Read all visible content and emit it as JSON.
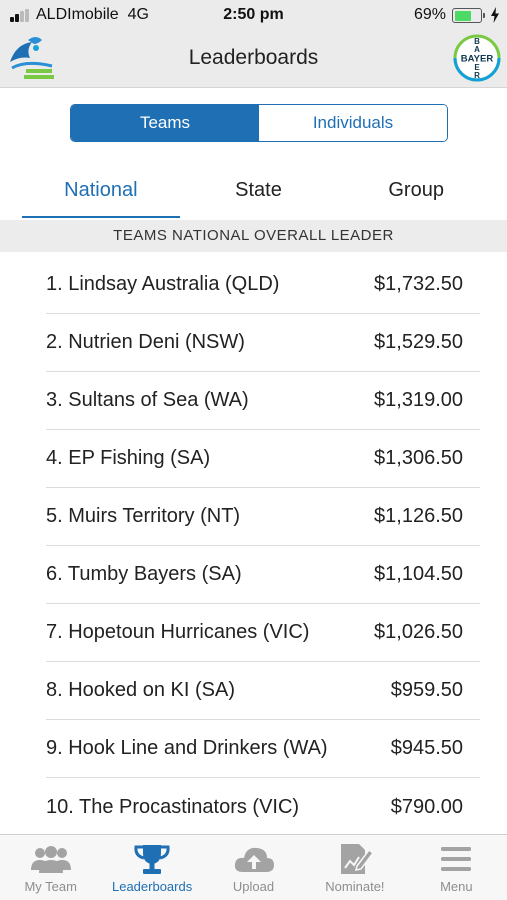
{
  "status_bar": {
    "carrier": "ALDImobile",
    "network": "4G",
    "time": "2:50 pm",
    "battery_pct": "69%",
    "battery_level": 0.69,
    "signal_bars": 2
  },
  "header": {
    "title": "Leaderboards",
    "left_logo_icon": "fishing-challenge-logo",
    "right_logo_icon": "bayer-cross-logo",
    "bayer_text": "BAYER"
  },
  "segmented": {
    "options": [
      "Teams",
      "Individuals"
    ],
    "selected": "Teams"
  },
  "tabs": {
    "items": [
      "National",
      "State",
      "Group"
    ],
    "selected": "National"
  },
  "section_title": "TEAMS NATIONAL OVERALL LEADER",
  "leaderboard": [
    {
      "name": "1. Lindsay Australia (QLD)",
      "amount": "$1,732.50"
    },
    {
      "name": "2. Nutrien Deni (NSW)",
      "amount": "$1,529.50"
    },
    {
      "name": "3. Sultans of Sea (WA)",
      "amount": "$1,319.00"
    },
    {
      "name": "4. EP Fishing (SA)",
      "amount": "$1,306.50"
    },
    {
      "name": "5. Muirs Territory (NT)",
      "amount": "$1,126.50"
    },
    {
      "name": "6. Tumby Bayers (SA)",
      "amount": "$1,104.50"
    },
    {
      "name": "7. Hopetoun Hurricanes (VIC)",
      "amount": "$1,026.50"
    },
    {
      "name": "8. Hooked on KI (SA)",
      "amount": "$959.50"
    },
    {
      "name": "9. Hook Line and Drinkers (WA)",
      "amount": "$945.50"
    },
    {
      "name": "10. The Procastinators (VIC)",
      "amount": "$790.00"
    }
  ],
  "bottom_nav": {
    "items": [
      {
        "label": "My Team",
        "icon": "team-icon"
      },
      {
        "label": "Leaderboards",
        "icon": "trophy-icon"
      },
      {
        "label": "Upload",
        "icon": "cloud-upload-icon"
      },
      {
        "label": "Nominate!",
        "icon": "nominate-icon"
      },
      {
        "label": "Menu",
        "icon": "menu-icon"
      }
    ],
    "selected": "Leaderboards"
  },
  "colors": {
    "accent": "#1f6fb5",
    "inactive": "#8e8e8e",
    "battery": "#4cd964"
  }
}
